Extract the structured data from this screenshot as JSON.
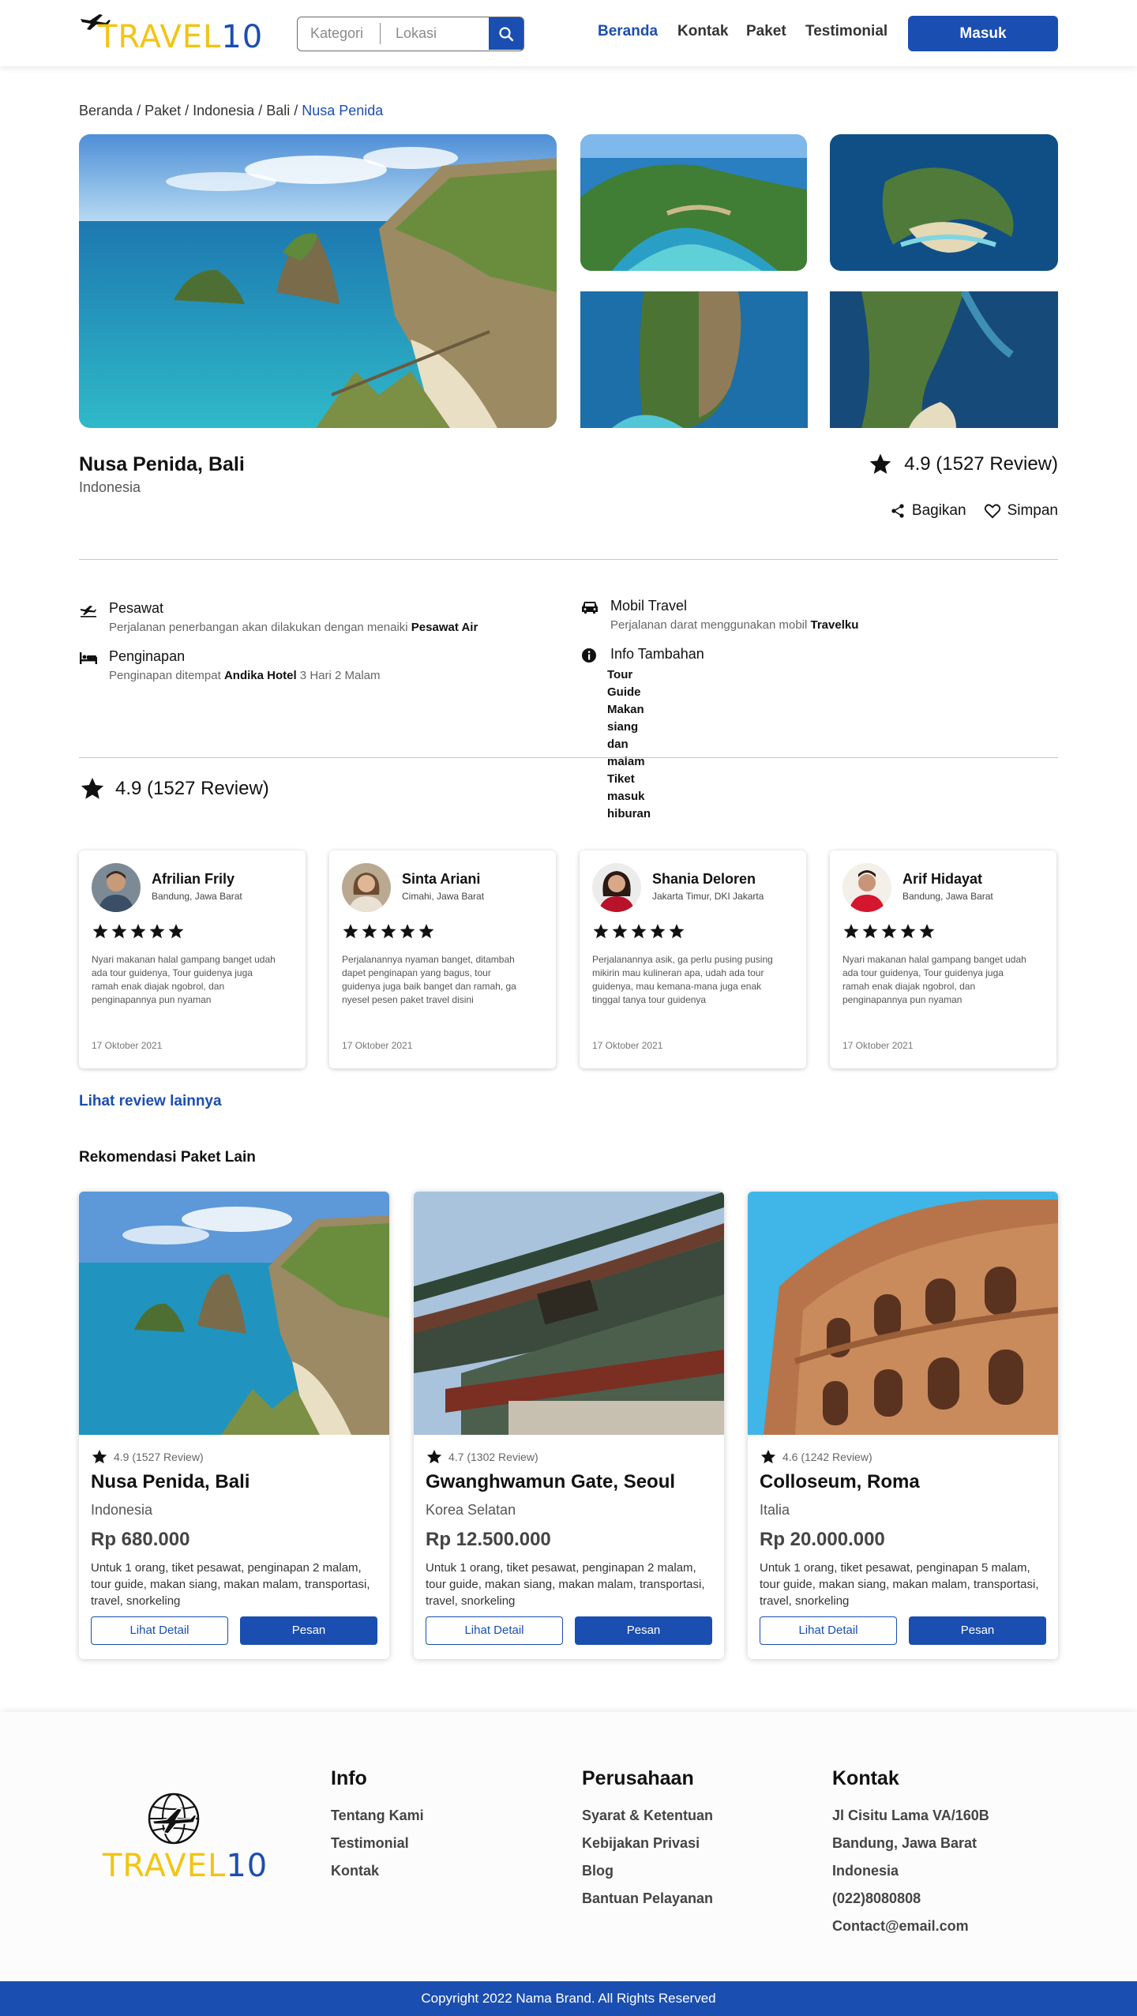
{
  "brand": {
    "logo_part1": "TRAVEL",
    "logo_part2": "10",
    "primary_color": "#1a4eb0",
    "accent_color": "#f2c414"
  },
  "header": {
    "search": {
      "category_placeholder": "Kategori",
      "location_placeholder": "Lokasi"
    },
    "nav": [
      {
        "label": "Beranda",
        "active": true
      },
      {
        "label": "Kontak",
        "active": false
      },
      {
        "label": "Paket",
        "active": false
      },
      {
        "label": "Testimonial",
        "active": false
      }
    ],
    "login_label": "Masuk"
  },
  "breadcrumb": {
    "items": [
      "Beranda",
      "Paket",
      "Indonesia",
      "Bali"
    ],
    "current": "Nusa Penida",
    "separator": " / "
  },
  "detail": {
    "title": "Nusa Penida, Bali",
    "country": "Indonesia",
    "rating": "4.9 (1527 Review)",
    "share_label": "Bagikan",
    "save_label": "Simpan"
  },
  "info": {
    "flight": {
      "title": "Pesawat",
      "desc": "Perjalanan penerbangan akan dilakukan dengan menaiki ",
      "highlight": "Pesawat Air"
    },
    "stay": {
      "title": "Penginapan",
      "desc": "Penginapan ditempat ",
      "highlight": "Andika Hotel",
      "desc_after": " 3 Hari 2 Malam"
    },
    "car": {
      "title": "Mobil Travel",
      "desc": "Perjalanan darat menggunakan mobil ",
      "highlight": "Travelku"
    },
    "extra": {
      "title": "Info Tambahan",
      "items": [
        "Tour Guide",
        "Makan siang dan malam",
        "Tiket masuk hiburan"
      ]
    }
  },
  "reviews": {
    "summary": "4.9 (1527 Review)",
    "items": [
      {
        "name": "Afrilian Frily",
        "location": "Bandung, Jawa Barat",
        "stars": 5,
        "text": "Nyari makanan halal gampang banget udah ada tour guidenya, Tour guidenya juga ramah enak diajak ngobrol, dan penginapannya pun nyaman",
        "date": "17 Oktober 2021"
      },
      {
        "name": "Sinta Ariani",
        "location": "Cimahi, Jawa Barat",
        "stars": 5,
        "text": "Perjalanannya nyaman banget, ditambah dapet penginapan yang bagus, tour guidenya juga baik banget dan ramah, ga nyesel pesen paket travel disini",
        "date": "17 Oktober 2021"
      },
      {
        "name": "Shania Deloren",
        "location": "Jakarta Timur, DKI Jakarta",
        "stars": 5,
        "text": "Perjalanannya asik, ga perlu pusing pusing mikirin mau kulineran apa, udah ada tour guidenya, mau kemana-mana juga enak tinggal tanya tour guidenya",
        "date": "17 Oktober 2021"
      },
      {
        "name": "Arif Hidayat",
        "location": "Bandung, Jawa Barat",
        "stars": 5,
        "text": "Nyari makanan halal gampang banget udah ada tour guidenya, Tour guidenya juga ramah enak diajak ngobrol, dan penginapannya pun nyaman",
        "date": "17 Oktober 2021"
      }
    ],
    "more_label": "Lihat review lainnya"
  },
  "recommendation": {
    "title": "Rekomendasi Paket Lain",
    "items": [
      {
        "rating": "4.9 (1527 Review)",
        "name": "Nusa Penida, Bali",
        "country": "Indonesia",
        "price": "Rp 680.000",
        "desc": "Untuk 1 orang, tiket pesawat, penginapan 2 malam, tour guide, makan siang, makan malam, transportasi, travel, snorkeling",
        "detail_label": "Lihat Detail",
        "order_label": "Pesan"
      },
      {
        "rating": "4.7 (1302 Review)",
        "name": "Gwanghwamun Gate, Seoul",
        "country": "Korea Selatan",
        "price": "Rp 12.500.000",
        "desc": "Untuk 1 orang, tiket pesawat, penginapan 2 malam, tour guide, makan siang, makan malam, transportasi, travel, snorkeling",
        "detail_label": "Lihat Detail",
        "order_label": "Pesan"
      },
      {
        "rating": "4.6 (1242 Review)",
        "name": "Colloseum, Roma",
        "country": "Italia",
        "price": "Rp 20.000.000",
        "desc": "Untuk 1 orang, tiket pesawat, penginapan 5 malam, tour guide, makan siang, makan malam, transportasi, travel, snorkeling",
        "detail_label": "Lihat Detail",
        "order_label": "Pesan"
      }
    ]
  },
  "footer": {
    "info": {
      "title": "Info",
      "links": [
        "Tentang Kami",
        "Testimonial",
        "Kontak"
      ]
    },
    "company": {
      "title": "Perusahaan",
      "links": [
        "Syarat & Ketentuan",
        "Kebijakan Privasi",
        "Blog",
        "Bantuan Pelayanan"
      ]
    },
    "contact": {
      "title": "Kontak",
      "lines": [
        "Jl Cisitu Lama VA/160B",
        "Bandung, Jawa Barat",
        "Indonesia",
        "(022)8080808",
        "Contact@email.com"
      ]
    },
    "copyright": "Copyright 2022 Nama Brand. All Rights Reserved"
  },
  "icons": [
    "airplane-icon",
    "search-icon",
    "star-icon",
    "share-icon",
    "heart-icon",
    "bed-icon",
    "car-icon",
    "info-icon",
    "globe-plane-icon"
  ]
}
